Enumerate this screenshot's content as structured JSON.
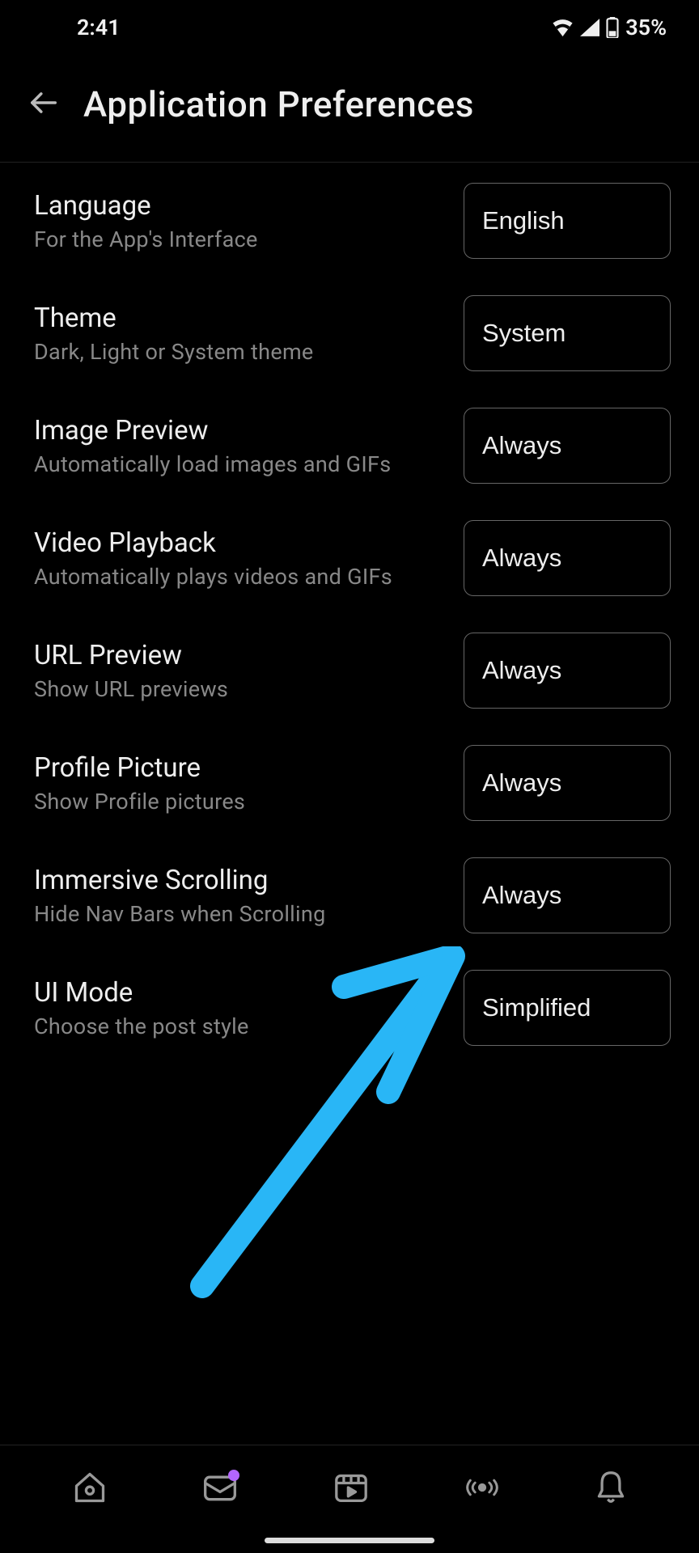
{
  "status": {
    "time": "2:41",
    "battery": "35%"
  },
  "header": {
    "title": "Application Preferences"
  },
  "settings": [
    {
      "title": "Language",
      "subtitle": "For the App's Interface",
      "value": "English"
    },
    {
      "title": "Theme",
      "subtitle": "Dark, Light or System theme",
      "value": "System"
    },
    {
      "title": "Image Preview",
      "subtitle": "Automatically load images and GIFs",
      "value": "Always"
    },
    {
      "title": "Video Playback",
      "subtitle": "Automatically plays videos and GIFs",
      "value": "Always"
    },
    {
      "title": "URL Preview",
      "subtitle": "Show URL previews",
      "value": "Always"
    },
    {
      "title": "Profile Picture",
      "subtitle": "Show Profile pictures",
      "value": "Always"
    },
    {
      "title": "Immersive Scrolling",
      "subtitle": "Hide Nav Bars when Scrolling",
      "value": "Always"
    },
    {
      "title": "UI Mode",
      "subtitle": "Choose the post style",
      "value": "Simplified"
    }
  ],
  "nav": {
    "home": "home-icon",
    "inbox": "inbox-icon",
    "media": "media-icon",
    "discover": "discover-icon",
    "notifications": "bell-icon"
  }
}
